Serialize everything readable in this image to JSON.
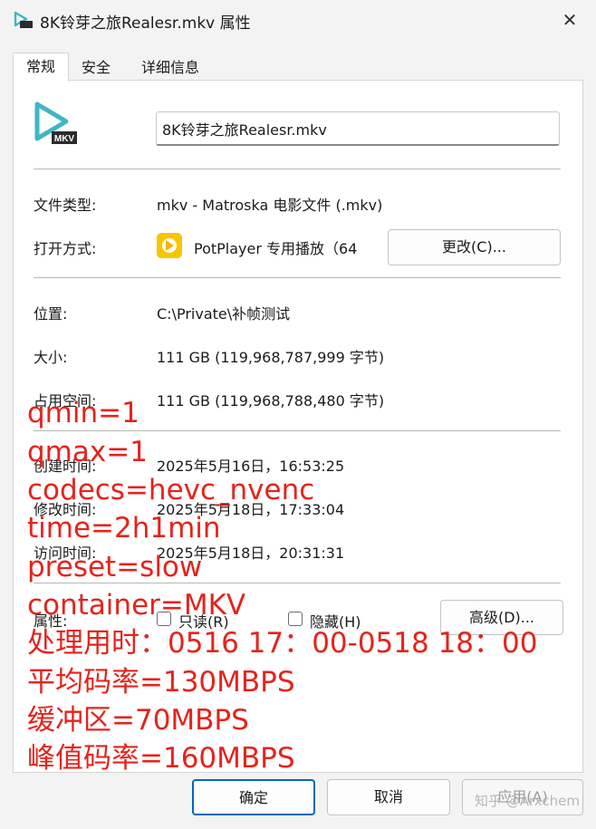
{
  "window": {
    "title": "8K铃芽之旅Realesr.mkv 属性",
    "close_glyph": "✕",
    "file_icon_badge": "MKV"
  },
  "tabs": [
    {
      "label": "常规"
    },
    {
      "label": "安全"
    },
    {
      "label": "详细信息"
    }
  ],
  "general": {
    "file_name": "8K铃芽之旅Realesr.mkv",
    "type_label": "文件类型:",
    "type_value": "mkv - Matroska 电影文件 (.mkv)",
    "opens_with_label": "打开方式:",
    "opens_with_value": "PotPlayer 专用播放（64",
    "change_button": "更改(C)...",
    "location_label": "位置:",
    "location_value": "C:\\Private\\补帧测试",
    "size_label": "大小:",
    "size_value": "111 GB (119,968,787,999 字节)",
    "disk_size_label": "占用空间:",
    "disk_size_value": "111 GB (119,968,788,480 字节)",
    "created_label": "创建时间:",
    "created_value": "2025年5月16日，16:53:25",
    "modified_label": "修改时间:",
    "modified_value": "2025年5月18日，17:33:04",
    "accessed_label": "访问时间:",
    "accessed_value": "2025年5月18日，20:31:31",
    "attributes_label": "属性:",
    "readonly_label": "只读(R)",
    "hidden_label": "隐藏(H)",
    "advanced_button": "高级(D)..."
  },
  "overlay_notes": [
    "qmin=1",
    "qmax=1",
    "codecs=hevc_nvenc",
    "time=2h1min",
    "preset=slow",
    "container=MKV",
    "处理用时：0516 17：00-0518 18：00",
    "平均码率=130MBPS",
    "缓冲区=70MBPS",
    "峰值码率=160MBPS"
  ],
  "footer": {
    "ok_button": "确定",
    "cancel_button": "取消",
    "apply_button": "应用(A)"
  },
  "watermark": "知乎 @Arxchem",
  "colors": {
    "overlay_text": "#e5231c",
    "mkv_icon": "#3fb6c4",
    "potplayer_icon": "#f7c600"
  }
}
